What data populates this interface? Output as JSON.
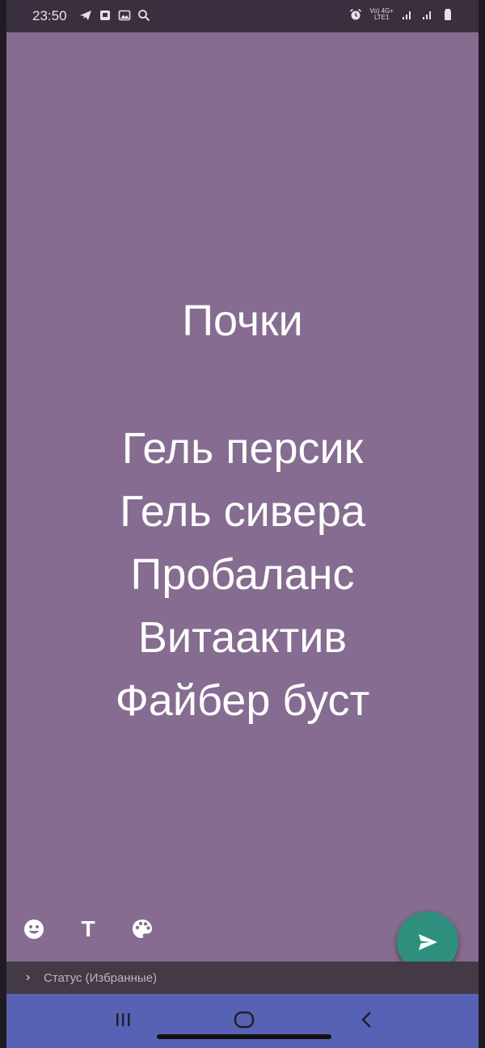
{
  "status_bar": {
    "time": "23:50",
    "left_icons": [
      "telegram-icon",
      "square-notification-icon",
      "gallery-icon",
      "search-icon"
    ],
    "network_top": "Vo) 4G+",
    "network_bottom": "LTE1",
    "right_icons": [
      "alarm-icon",
      "signal-1-icon",
      "signal-2-icon",
      "battery-icon"
    ]
  },
  "canvas": {
    "background": "#856c90",
    "title": "Почки",
    "lines": [
      "Гель персик",
      "Гель сивера",
      "Пробаланс",
      "Витаактив",
      "Файбер буст"
    ]
  },
  "tools": {
    "emoji_icon": "emoji-icon",
    "text_label": "T",
    "palette_icon": "palette-icon"
  },
  "send_button": {
    "color": "#2f8f7f",
    "icon": "send-icon"
  },
  "audience": {
    "chevron": "›",
    "label": "Статус (Избранные)"
  },
  "nav_bar": {
    "background": "#5862b4",
    "recents_label": "III",
    "home_icon": "home-icon",
    "back_icon": "back-icon"
  }
}
